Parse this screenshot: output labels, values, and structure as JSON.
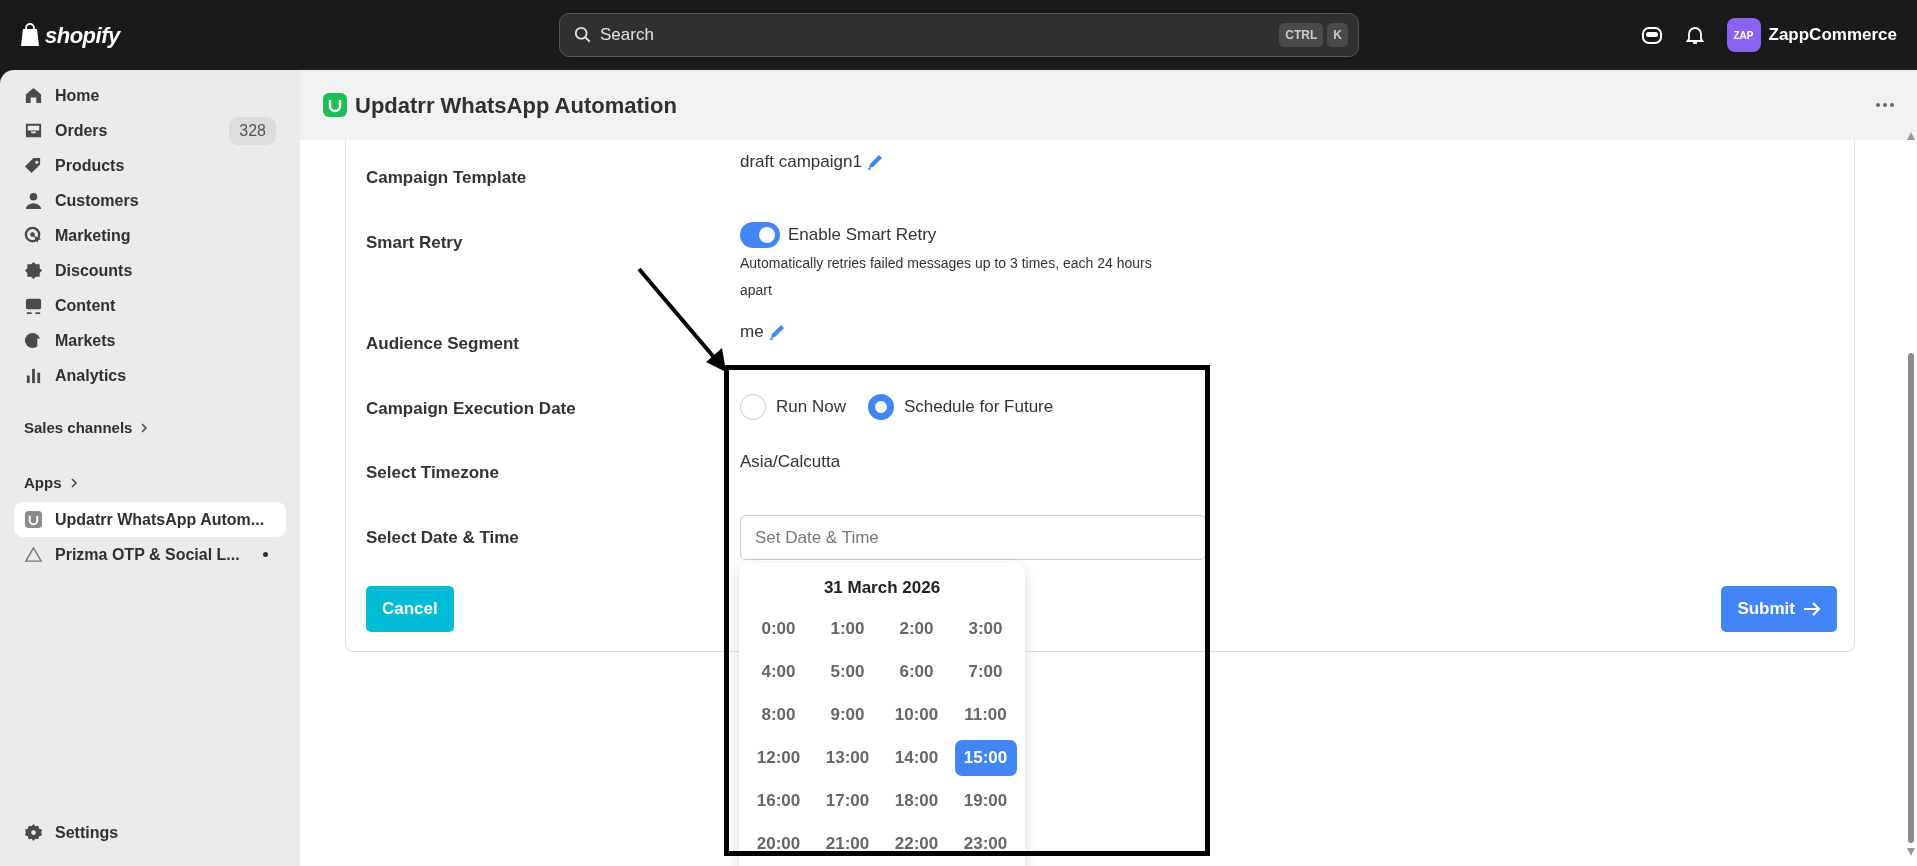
{
  "topbar": {
    "logo": "shopify",
    "search": {
      "placeholder": "Search",
      "shortcut": [
        "CTRL",
        "K"
      ]
    },
    "store": {
      "initials": "ZAP",
      "name": "ZappCommerce"
    }
  },
  "sidebar": {
    "items": [
      {
        "label": "Home"
      },
      {
        "label": "Orders",
        "count": "328"
      },
      {
        "label": "Products"
      },
      {
        "label": "Customers"
      },
      {
        "label": "Marketing"
      },
      {
        "label": "Discounts"
      },
      {
        "label": "Content"
      },
      {
        "label": "Markets"
      },
      {
        "label": "Analytics"
      }
    ],
    "sales_channels": "Sales channels",
    "apps_heading": "Apps",
    "apps": [
      {
        "label": "Updatrr WhatsApp Autom...",
        "selected": true,
        "unread": false
      },
      {
        "label": "Prizma OTP & Social L...",
        "selected": false,
        "unread": true
      }
    ],
    "settings": "Settings"
  },
  "app_header": {
    "title": "Updatrr WhatsApp Automation"
  },
  "form": {
    "rows": [
      {
        "kind": "editable",
        "label": "Campaign Template",
        "value": "draft campaign1"
      },
      {
        "kind": "toggle",
        "label": "Smart Retry",
        "toggle_label": "Enable Smart Retry",
        "on": true,
        "help": "Automatically retries failed messages up to 3 times, each 24 hours apart"
      },
      {
        "kind": "editable",
        "label": "Audience Segment",
        "value": "me"
      },
      {
        "kind": "radio",
        "label": "Campaign Execution Date",
        "options": [
          {
            "label": "Run Now",
            "selected": false
          },
          {
            "label": "Schedule for Future",
            "selected": true
          }
        ]
      },
      {
        "kind": "text",
        "label": "Select Timezone",
        "value": "Asia/Calcutta"
      },
      {
        "kind": "datetime",
        "label": "Select Date & Time",
        "placeholder": "Set Date & Time"
      }
    ],
    "cancel": "Cancel",
    "submit": "Submit"
  },
  "time_picker": {
    "title": "31 March 2026",
    "times": [
      {
        "label": "0:00",
        "selected": false
      },
      {
        "label": "1:00",
        "selected": false
      },
      {
        "label": "2:00",
        "selected": false
      },
      {
        "label": "3:00",
        "selected": false
      },
      {
        "label": "4:00",
        "selected": false
      },
      {
        "label": "5:00",
        "selected": false
      },
      {
        "label": "6:00",
        "selected": false
      },
      {
        "label": "7:00",
        "selected": false
      },
      {
        "label": "8:00",
        "selected": false
      },
      {
        "label": "9:00",
        "selected": false
      },
      {
        "label": "10:00",
        "selected": false
      },
      {
        "label": "11:00",
        "selected": false
      },
      {
        "label": "12:00",
        "selected": false
      },
      {
        "label": "13:00",
        "selected": false
      },
      {
        "label": "14:00",
        "selected": false
      },
      {
        "label": "15:00",
        "selected": true
      },
      {
        "label": "16:00",
        "selected": false
      },
      {
        "label": "17:00",
        "selected": false
      },
      {
        "label": "18:00",
        "selected": false
      },
      {
        "label": "19:00",
        "selected": false
      },
      {
        "label": "20:00",
        "selected": false
      },
      {
        "label": "21:00",
        "selected": false
      },
      {
        "label": "22:00",
        "selected": false
      },
      {
        "label": "23:00",
        "selected": false
      }
    ]
  }
}
